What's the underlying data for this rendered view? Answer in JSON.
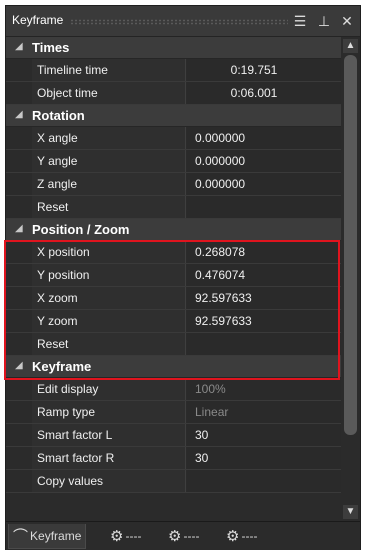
{
  "panel": {
    "title": "Keyframe",
    "buttons": {
      "menu": "☰",
      "pin": "⊥",
      "close": "✕"
    }
  },
  "sections": [
    {
      "label": "Times",
      "rows": [
        {
          "name": "Timeline time",
          "value": "0:19.751",
          "align": "center"
        },
        {
          "name": "Object time",
          "value": "0:06.001",
          "align": "center"
        }
      ]
    },
    {
      "label": "Rotation",
      "rows": [
        {
          "name": "X angle",
          "value": "0.000000"
        },
        {
          "name": "Y angle",
          "value": "0.000000"
        },
        {
          "name": "Z angle",
          "value": "0.000000"
        },
        {
          "name": "Reset",
          "value": ""
        }
      ]
    },
    {
      "label": "Position / Zoom",
      "rows": [
        {
          "name": "X position",
          "value": "0.268078"
        },
        {
          "name": "Y position",
          "value": "0.476074"
        },
        {
          "name": "X zoom",
          "value": "92.597633"
        },
        {
          "name": "Y zoom",
          "value": "92.597633"
        },
        {
          "name": "Reset",
          "value": ""
        }
      ]
    },
    {
      "label": "Keyframe",
      "rows": [
        {
          "name": "Edit display",
          "value": "100%",
          "dim": true
        },
        {
          "name": "Ramp type",
          "value": "Linear",
          "dim": true
        },
        {
          "name": "Smart factor L",
          "value": "30"
        },
        {
          "name": "Smart factor R",
          "value": "30"
        },
        {
          "name": "Copy values",
          "value": ""
        }
      ]
    }
  ],
  "tabs": [
    {
      "label": "Keyframe",
      "icon": "keyframe-icon",
      "active": true
    },
    {
      "label": "----",
      "icon": "gear-icon"
    },
    {
      "label": "----",
      "icon": "gear-icon"
    },
    {
      "label": "----",
      "icon": "gear-icon"
    }
  ],
  "highlight_color": "#e0141e"
}
